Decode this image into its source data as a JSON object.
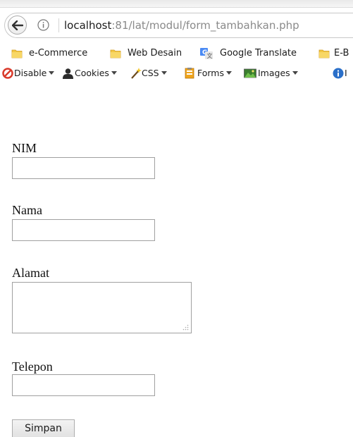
{
  "browser": {
    "url_host": "localhost",
    "url_path": ":81/lat/modul/form_tambahkan.php",
    "bookmarks": [
      {
        "label": "e-Commerce",
        "icon": "folder-icon"
      },
      {
        "label": "Web Desain",
        "icon": "folder-icon"
      },
      {
        "label": "Google Translate",
        "icon": "google-translate-icon"
      },
      {
        "label": "E-B",
        "icon": "folder-icon"
      }
    ],
    "devbar": [
      {
        "label": "Disable",
        "icon": "disable-icon"
      },
      {
        "label": "Cookies",
        "icon": "cookies-icon"
      },
      {
        "label": "CSS",
        "icon": "css-icon"
      },
      {
        "label": "Forms",
        "icon": "forms-icon"
      },
      {
        "label": "Images",
        "icon": "images-icon"
      },
      {
        "label": "I",
        "icon": "information-icon"
      }
    ]
  },
  "form": {
    "nim_label": "NIM",
    "nim_value": "",
    "nama_label": "Nama",
    "nama_value": "",
    "alamat_label": "Alamat",
    "alamat_value": "",
    "telepon_label": "Telepon",
    "telepon_value": "",
    "submit_label": "Simpan"
  }
}
